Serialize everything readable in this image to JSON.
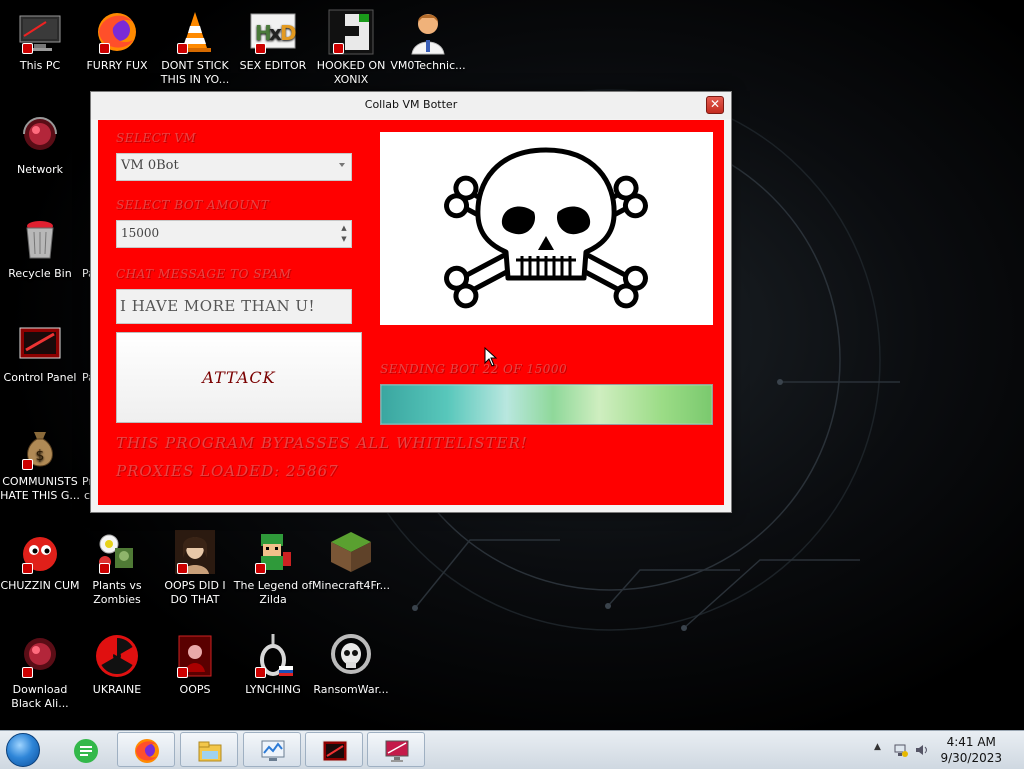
{
  "desktop": {
    "icons": [
      {
        "label": "This PC",
        "icon": "computer-icon"
      },
      {
        "label": "FURRY FUX",
        "icon": "firefox-icon"
      },
      {
        "label": "DONT STICK THIS IN YO...",
        "icon": "vlc-cone-icon"
      },
      {
        "label": "SEX EDITOR",
        "icon": "hxd-icon"
      },
      {
        "label": "HOOKED ON XONIX",
        "icon": "xonix-game-icon"
      },
      {
        "label": "VM0Technic...",
        "icon": "doctor-avatar-icon"
      },
      {
        "label": "Network",
        "icon": "network-icon"
      },
      {
        "label": "Recycle Bin",
        "icon": "recycle-bin-icon"
      },
      {
        "label": "Control Panel",
        "icon": "control-panel-icon"
      },
      {
        "label": "COMMUNISTS HATE THIS G...",
        "icon": "money-bag-icon"
      },
      {
        "label": "CHUZZIN CUM",
        "icon": "chuzzle-icon"
      },
      {
        "label": "Plants vs Zombies",
        "icon": "plants-vs-zombies-icon"
      },
      {
        "label": "OOPS DID I DO THAT",
        "icon": "portrait-icon"
      },
      {
        "label": "The Legend of Zilda",
        "icon": "zelda-icon"
      },
      {
        "label": "Minecraft4Fr...",
        "icon": "minecraft-icon"
      },
      {
        "label": "Download Black Ali...",
        "icon": "download-icon"
      },
      {
        "label": "UKRAINE",
        "icon": "radiation-icon"
      },
      {
        "label": "OOPS",
        "icon": "oops-icon"
      },
      {
        "label": "LYNCHING",
        "icon": "noose-icon"
      },
      {
        "label": "RansomWar...",
        "icon": "ransomware-skull-icon"
      }
    ],
    "clipped_labels": [
      "Pa",
      "Pa",
      "Pr",
      "c"
    ]
  },
  "window": {
    "title": "Collab VM Botter",
    "close_glyph": "✕",
    "select_vm_label": "SELECT VM",
    "select_vm_value": "VM 0Bot",
    "bot_amount_label": "SELECT BOT AMOUNT",
    "bot_amount_value": "15000",
    "chat_label": "CHAT MESSAGE TO SPAM",
    "chat_value": "I HAVE MORE THAN U!",
    "attack_label": "ATTACK",
    "sending_status": "SENDING BOT 22 OF 15000",
    "progress_fraction": 1.0,
    "bypass_text": "THIS PROGRAM BYPASSES ALL WHITELISTER!",
    "proxies_text": "PROXIES LOADED: 25867",
    "image_icon": "skull-crossbones-icon"
  },
  "taskbar": {
    "items": [
      "start-orb-icon",
      "sticky-notes-icon",
      "firefox-icon",
      "file-explorer-icon",
      "task-manager-icon",
      "control-panel-icon",
      "display-icon"
    ],
    "time": "4:41 AM",
    "date": "9/30/2023",
    "tray_arrow": "▲"
  },
  "colors": {
    "client_red": "#ff0000",
    "label_red": "#e84545"
  }
}
